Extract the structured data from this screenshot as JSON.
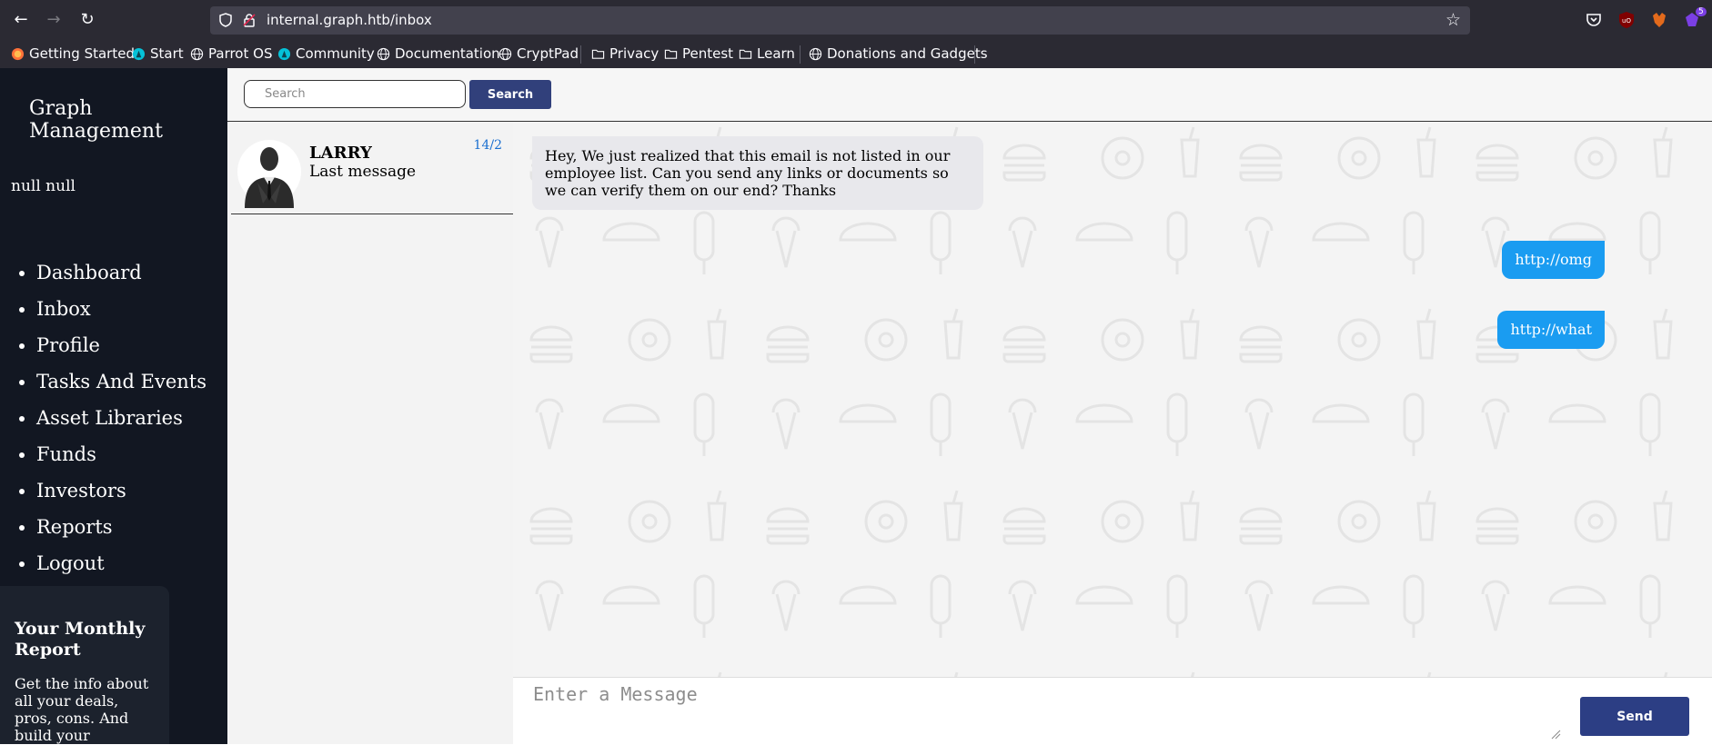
{
  "browser": {
    "url": "internal.graph.htb/inbox",
    "back_icon": "arrow-left-icon",
    "forward_icon": "arrow-right-icon",
    "reload_icon": "reload-icon",
    "extension_badge": "5",
    "bookmarks": [
      {
        "label": "Getting Started",
        "icon": "firefox-icon"
      },
      {
        "label": "Start",
        "icon": "parrot-icon"
      },
      {
        "label": "Parrot OS",
        "icon": "globe-icon"
      },
      {
        "label": "Community",
        "icon": "parrot-icon"
      },
      {
        "label": "Documentation",
        "icon": "globe-icon"
      },
      {
        "label": "CryptPad",
        "icon": "globe-icon"
      },
      {
        "label": "Privacy",
        "icon": "folder-icon"
      },
      {
        "label": "Pentest",
        "icon": "folder-icon"
      },
      {
        "label": "Learn",
        "icon": "folder-icon"
      },
      {
        "label": "Donations and Gadgets",
        "icon": "globe-icon"
      }
    ]
  },
  "sidebar": {
    "brand": "Graph Management",
    "username": "null null",
    "menu": [
      {
        "label": "Dashboard"
      },
      {
        "label": "Inbox"
      },
      {
        "label": "Profile"
      },
      {
        "label": "Tasks And Events"
      },
      {
        "label": "Asset Libraries"
      },
      {
        "label": "Funds"
      },
      {
        "label": "Investors"
      },
      {
        "label": "Reports"
      },
      {
        "label": "Logout"
      }
    ],
    "report_card": {
      "title": "Your Monthly Report",
      "desc": "Get the info about all your deals, pros, cons. And build your"
    }
  },
  "search": {
    "placeholder": "Search",
    "button": "Search"
  },
  "conversations": [
    {
      "name": "LARRY",
      "last": "Last message",
      "date": "14/2"
    }
  ],
  "messages": [
    {
      "direction": "in",
      "text": "Hey, We just realized that this email is not listed in our employee list. Can you send any links or documents so we can verify them on our end? Thanks"
    },
    {
      "direction": "out",
      "text": "http://omg"
    },
    {
      "direction": "out",
      "text": "http://what"
    }
  ],
  "composer": {
    "placeholder": "Enter a Message",
    "send": "Send"
  },
  "colors": {
    "sidebar_bg": "#121722",
    "primary_button": "#31407b",
    "outgoing_bubble": "#1a9cf1",
    "incoming_bubble": "#e8e8ec",
    "date_text": "#1a6fd0"
  }
}
